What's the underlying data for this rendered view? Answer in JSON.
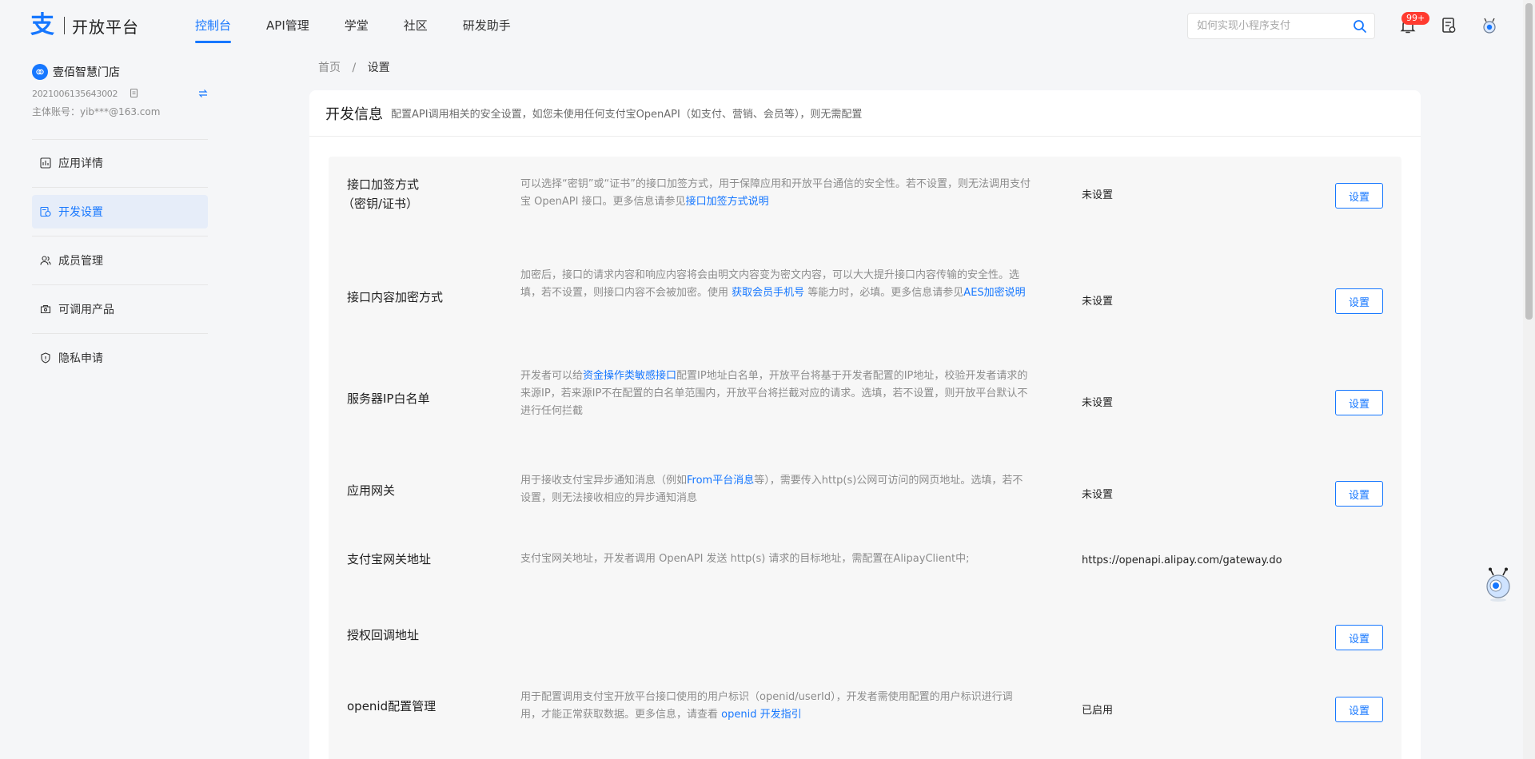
{
  "header": {
    "logo_glyph": "支",
    "logo_text": "开放平台",
    "nav": [
      {
        "label": "控制台",
        "active": true
      },
      {
        "label": "API管理"
      },
      {
        "label": "学堂"
      },
      {
        "label": "社区"
      },
      {
        "label": "研发助手"
      }
    ],
    "search_placeholder": "如何实现小程序支付",
    "notification_badge": "99+"
  },
  "sidebar": {
    "store_name": "壹佰智慧门店",
    "store_id": "2021006135643002",
    "account": "主体账号：yib***@163.com",
    "items": [
      {
        "label": "应用详情",
        "icon": "chart-icon"
      },
      {
        "label": "开发设置",
        "icon": "settings-icon",
        "active": true
      },
      {
        "label": "成员管理",
        "icon": "members-icon"
      },
      {
        "label": "可调用产品",
        "icon": "products-icon"
      },
      {
        "label": "隐私申请",
        "icon": "shield-icon"
      }
    ]
  },
  "breadcrumb": {
    "home": "首页",
    "sep": "/",
    "current": "设置"
  },
  "card": {
    "title": "开发信息",
    "description": "配置API调用相关的安全设置，如您未使用任何支付宝OpenAPI（如支付、营销、会员等），则无需配置"
  },
  "rows": [
    {
      "label_line1": "接口加签方式",
      "label_line2": "（密钥/证书）",
      "desc_pre": "可以选择“密钥”或“证书”的接口加签方式，用于保障应用和开放平台通信的安全性。若不设置，则无法调用支付宝 OpenAPI 接口。更多信息请参见",
      "desc_link": "接口加签方式说明",
      "desc_post": "",
      "status": "未设置",
      "button": "设置"
    },
    {
      "label_line1": "接口内容加密方式",
      "desc_pre": "加密后，接口的请求内容和响应内容将会由明文内容变为密文内容，可以大大提升接口内容传输的安全性。选填，若不设置，则接口内容不会被加密。使用 ",
      "desc_link": "获取会员手机号",
      "desc_post": " 等能力时，必填。更多信息请参见",
      "desc_link2": "AES加密说明",
      "status": "未设置",
      "button": "设置"
    },
    {
      "label_line1": "服务器IP白名单",
      "desc_pre": "开发者可以给",
      "desc_link": "资金操作类敏感接口",
      "desc_post": "配置IP地址白名单，开放平台将基于开发者配置的IP地址，校验开发者请求的来源IP，若来源IP不在配置的白名单范围内，开放平台将拦截对应的请求。选填，若不设置，则开放平台默认不进行任何拦截",
      "status": "未设置",
      "button": "设置"
    },
    {
      "label_line1": "应用网关",
      "desc_pre": "用于接收支付宝异步通知消息（例如",
      "desc_link": "From平台消息",
      "desc_post": "等），需要传入http(s)公网可访问的网页地址。选填，若不设置，则无法接收相应的异步通知消息",
      "status": "未设置",
      "button": "设置"
    },
    {
      "label_line1": "支付宝网关地址",
      "desc_pre": "支付宝网关地址，开发者调用 OpenAPI 发送 http(s) 请求的目标地址，需配置在AlipayClient中;",
      "status": "https://openapi.alipay.com/gateway.do"
    },
    {
      "label_line1": "授权回调地址",
      "button": "设置"
    },
    {
      "label_line1": "openid配置管理",
      "desc_pre": "用于配置调用支付宝开放平台接口使用的用户标识（openid/userId），开发者需使用配置的用户标识进行调用，才能正常获取数据。更多信息，请查看 ",
      "desc_link": "openid 开发指引",
      "desc_post": "",
      "status": "已启用",
      "button": "设置"
    }
  ],
  "colors": {
    "accent": "#1677ff",
    "badge": "#ff3b30",
    "active_bg": "#e6edf9"
  }
}
